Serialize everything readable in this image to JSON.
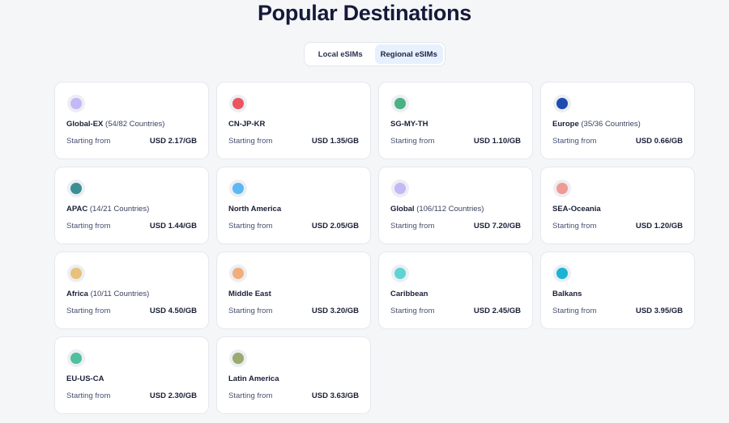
{
  "page": {
    "title": "Popular Destinations"
  },
  "tabs": [
    {
      "label": "Local eSIMs",
      "active": false
    },
    {
      "label": "Regional eSIMs",
      "active": true
    }
  ],
  "cards": [
    {
      "name": "Global-EX",
      "sub": "(54/82 Countries)",
      "starting_label": "Starting from",
      "price": "USD 2.17/GB",
      "color": "#c4b8f8",
      "icon": "globe-flag-icon"
    },
    {
      "name": "CN-JP-KR",
      "sub": "",
      "starting_label": "Starting from",
      "price": "USD 1.35/GB",
      "color": "#ea5560",
      "icon": "cn-jp-kr-flag-icon"
    },
    {
      "name": "SG-MY-TH",
      "sub": "",
      "starting_label": "Starting from",
      "price": "USD 1.10/GB",
      "color": "#49b183",
      "icon": "sg-my-th-flag-icon"
    },
    {
      "name": "Europe",
      "sub": "(35/36 Countries)",
      "starting_label": "Starting from",
      "price": "USD 0.66/GB",
      "color": "#1e4db0",
      "icon": "eu-flag-icon"
    },
    {
      "name": "APAC",
      "sub": "(14/21 Countries)",
      "starting_label": "Starting from",
      "price": "USD 1.44/GB",
      "color": "#3a8f93",
      "icon": "apac-flag-icon"
    },
    {
      "name": "North America",
      "sub": "",
      "starting_label": "Starting from",
      "price": "USD 2.05/GB",
      "color": "#5bb8f2",
      "icon": "north-america-flag-icon"
    },
    {
      "name": "Global",
      "sub": "(106/112 Countries)",
      "starting_label": "Starting from",
      "price": "USD 7.20/GB",
      "color": "#c4b8f8",
      "icon": "globe-flag-icon"
    },
    {
      "name": "SEA-Oceania",
      "sub": "",
      "starting_label": "Starting from",
      "price": "USD 1.20/GB",
      "color": "#f09a94",
      "icon": "sea-oceania-flag-icon"
    },
    {
      "name": "Africa",
      "sub": "(10/11 Countries)",
      "starting_label": "Starting from",
      "price": "USD 4.50/GB",
      "color": "#e8c27a",
      "icon": "africa-flag-icon"
    },
    {
      "name": "Middle East",
      "sub": "",
      "starting_label": "Starting from",
      "price": "USD 3.20/GB",
      "color": "#f0ae7c",
      "icon": "middle-east-flag-icon"
    },
    {
      "name": "Caribbean",
      "sub": "",
      "starting_label": "Starting from",
      "price": "USD 2.45/GB",
      "color": "#5fd3d4",
      "icon": "caribbean-flag-icon"
    },
    {
      "name": "Balkans",
      "sub": "",
      "starting_label": "Starting from",
      "price": "USD 3.95/GB",
      "color": "#1ab3d6",
      "icon": "balkans-flag-icon"
    },
    {
      "name": "EU-US-CA",
      "sub": "",
      "starting_label": "Starting from",
      "price": "USD 2.30/GB",
      "color": "#4fbf9c",
      "icon": "eu-us-ca-flag-icon"
    },
    {
      "name": "Latin America",
      "sub": "",
      "starting_label": "Starting from",
      "price": "USD 3.63/GB",
      "color": "#9aab6e",
      "icon": "latin-america-flag-icon"
    }
  ]
}
